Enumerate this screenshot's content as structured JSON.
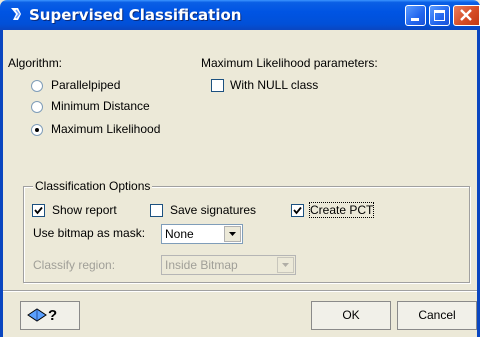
{
  "window": {
    "title": "Supervised Classification"
  },
  "algorithm": {
    "heading": "Algorithm:",
    "options": [
      "Parallelpiped",
      "Minimum Distance",
      "Maximum Likelihood"
    ],
    "selected_index": 2
  },
  "ml_params": {
    "heading": "Maximum Likelihood parameters:",
    "null_class_label": "With NULL class",
    "null_class_checked": false
  },
  "classification_options": {
    "title": "Classification Options",
    "show_report_label": "Show report",
    "show_report_checked": true,
    "save_signatures_label": "Save signatures",
    "save_signatures_checked": false,
    "create_pct_label": "Create PCT",
    "create_pct_checked": true,
    "bitmap_mask_label": "Use bitmap as mask:",
    "bitmap_mask_value": "None",
    "classify_region_label": "Classify region:",
    "classify_region_value": "Inside Bitmap"
  },
  "footer": {
    "help_icon": "help-cursor-icon",
    "help_text": "?",
    "ok_label": "OK",
    "cancel_label": "Cancel"
  },
  "colors": {
    "titlebar": "#0054e3",
    "dialog_bg": "#ece9d8",
    "close_button": "#d44a23"
  }
}
